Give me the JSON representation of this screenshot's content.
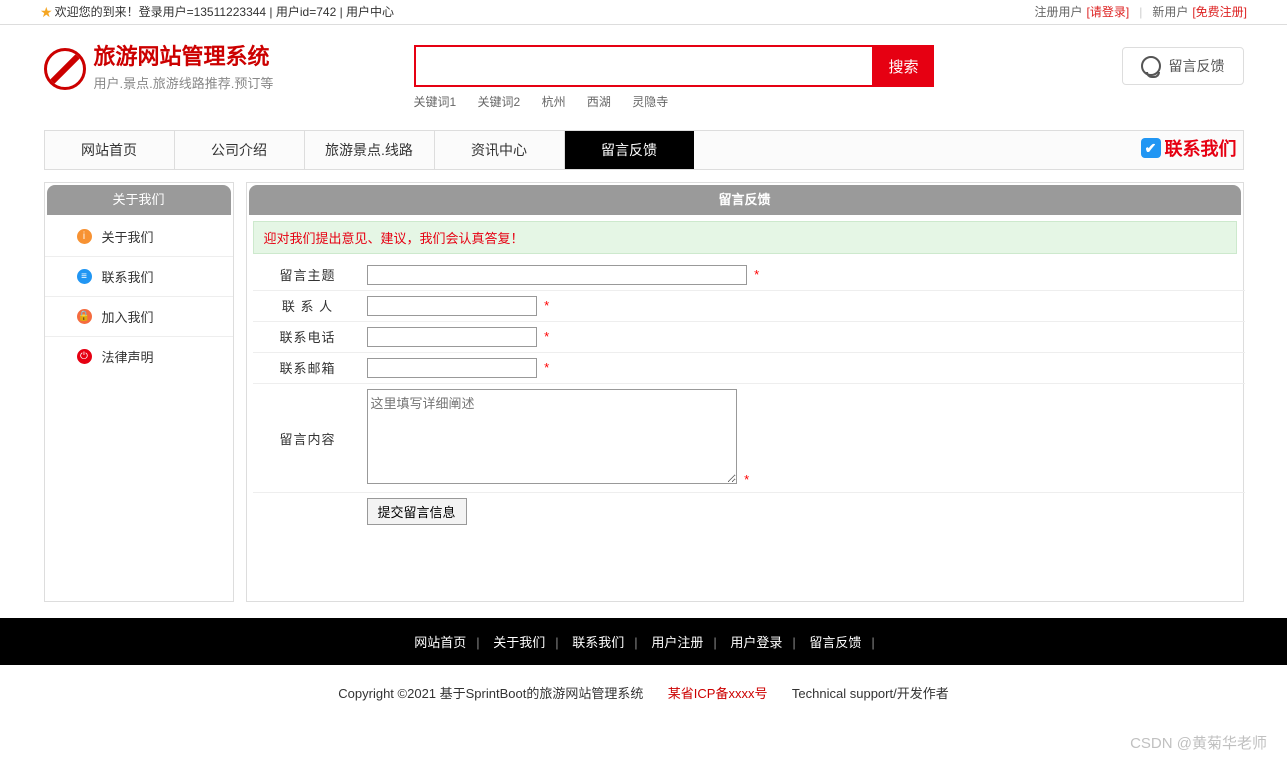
{
  "topbar": {
    "welcome": "欢迎您的到来！登录用户=13511223344 | 用户id=742 | 用户中心",
    "reg_user_label": "注册用户",
    "login_link": "[请登录]",
    "new_user_label": "新用户",
    "free_reg_link": "[免费注册]"
  },
  "site": {
    "title": "旅游网站管理系统",
    "subtitle": "用户.景点.旅游线路推荐.预订等"
  },
  "search": {
    "button": "搜索",
    "keywords": [
      "关键词1",
      "关键词2",
      "杭州",
      "西湖",
      "灵隐寺"
    ]
  },
  "header_feedback_btn": "留言反馈",
  "nav": {
    "items": [
      {
        "label": "网站首页",
        "active": false
      },
      {
        "label": "公司介绍",
        "active": false
      },
      {
        "label": "旅游景点.线路",
        "active": false
      },
      {
        "label": "资讯中心",
        "active": false
      },
      {
        "label": "留言反馈",
        "active": true
      }
    ],
    "contact": "联系我们"
  },
  "sidebar": {
    "title": "关于我们",
    "items": [
      {
        "label": "关于我们",
        "icon": "info"
      },
      {
        "label": "联系我们",
        "icon": "list"
      },
      {
        "label": "加入我们",
        "icon": "lock"
      },
      {
        "label": "法律声明",
        "icon": "power"
      }
    ]
  },
  "panel": {
    "title": "留言反馈",
    "notice": "迎对我们提出意见、建议，我们会认真答复！"
  },
  "form": {
    "subject_label": "留言主题",
    "contact_label": "联 系 人",
    "phone_label": "联系电话",
    "email_label": "联系邮箱",
    "content_label": "留言内容",
    "content_placeholder": "这里填写详细阐述",
    "submit": "提交留言信息",
    "required_mark": "*"
  },
  "footer": {
    "links": [
      "网站首页",
      "关于我们",
      "联系我们",
      "用户注册",
      "用户登录",
      "留言反馈"
    ],
    "copyright_prefix": "Copyright ©2021 基于SprintBoot的旅游网站管理系统",
    "icp": "某省ICP备xxxx号",
    "tech": "Technical support/开发作者"
  },
  "watermark": "CSDN @黄菊华老师"
}
